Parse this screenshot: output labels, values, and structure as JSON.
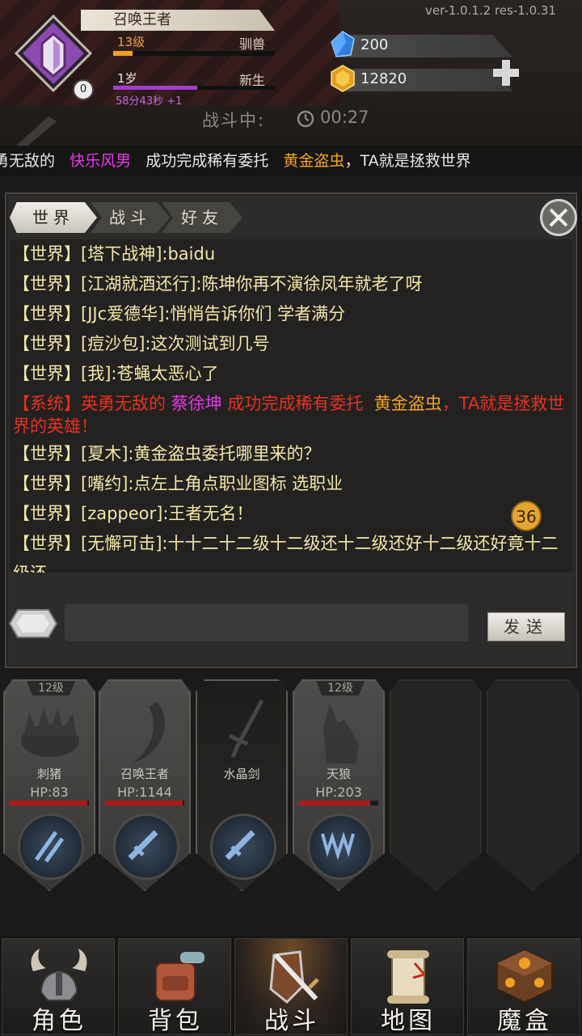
{
  "header": {
    "player_name": "召唤王者",
    "level": "13级",
    "title": "驯兽",
    "age": "1岁",
    "stage": "新生",
    "age_timer": "58分43秒 +1",
    "badge_count": "0",
    "exp_progress": 0.12,
    "age_progress": 0.52,
    "version": "ver-1.0.1.2  res-1.0.31",
    "crystals": "200",
    "gold": "12820",
    "battle_status": "战斗中:",
    "battle_time": "00:27"
  },
  "marquee": {
    "prefix": "勇无敌的",
    "player": "快乐风男",
    "middle": "成功完成稀有委托",
    "quest": "黄金盗虫",
    "suffix": "，TA就是拯救世界"
  },
  "chat": {
    "tabs": [
      "世界",
      "战斗",
      "好友"
    ],
    "messages": [
      {
        "channel": "【世界】",
        "text": "[塔下战神]:baidu"
      },
      {
        "channel": "【世界】",
        "text": "[江湖就酒还行]:陈坤你再不演徐凤年就老了呀"
      },
      {
        "channel": "【世界】",
        "text": "[JJc爱德华]:悄悄告诉你们 学者满分"
      },
      {
        "channel": "【世界】",
        "text": "[痘沙包]:这次测试到几号"
      },
      {
        "channel": "【世界】",
        "text": "[我]:苍蝇太恶心了"
      }
    ],
    "system": {
      "channel": "【系统】",
      "prefix": "英勇无敌的",
      "player": "蔡徐坤",
      "middle": "成功完成稀有委托",
      "quest": "黄金盗虫",
      "suffix": "，TA就是拯救世界的英雄！"
    },
    "messages_after": [
      {
        "channel": "【世界】",
        "text": "[夏木]:黄金盗虫委托哪里来的？"
      },
      {
        "channel": "【世界】",
        "text": "[嘴约]:点左上角点职业图标 选职业"
      },
      {
        "channel": "【世界】",
        "text": "[zappeor]:王者无名！"
      },
      {
        "channel": "【世界】",
        "text": "[无懈可击]:十十二十二级十二级还十二级还好十二级还好竟十二级还"
      }
    ],
    "unread": "36",
    "input_value": "",
    "send_label": "发送"
  },
  "team": [
    {
      "level": "12级",
      "name": "刺猪",
      "hp": "HP:83",
      "hp_ratio": 0.98
    },
    {
      "level": "",
      "name": "召唤王者",
      "hp": "HP:1144",
      "hp_ratio": 0.98
    },
    {
      "level": "",
      "name": "水晶剑",
      "hp": "",
      "hp_ratio": 0
    },
    {
      "level": "12级",
      "name": "天狼",
      "hp": "HP:203",
      "hp_ratio": 0.9
    }
  ],
  "nav": [
    "角色",
    "背包",
    "战斗",
    "地图",
    "魔盒"
  ],
  "colors": {
    "accent_gold": "#f0a418",
    "system_red": "#e43020",
    "player_pink": "#e23ae0",
    "chat_text": "#f3e6a8"
  }
}
